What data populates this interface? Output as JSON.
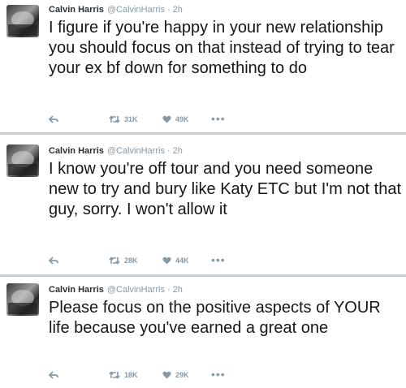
{
  "tweets": [
    {
      "name": "Calvin Harris",
      "handle": "@CalvinHarris",
      "separator": "·",
      "time": "2h",
      "text": "I figure if you're happy in your new relationship you should focus on that instead of trying to tear your ex bf down for something to do",
      "retweets": "31K",
      "likes": "49K",
      "more": "•••"
    },
    {
      "name": "Calvin Harris",
      "handle": "@CalvinHarris",
      "separator": "·",
      "time": "2h",
      "text": "I know you're off tour and you need someone new to try and bury like Katy ETC but I'm not that guy, sorry. I won't allow it",
      "retweets": "28K",
      "likes": "44K",
      "more": "•••"
    },
    {
      "name": "Calvin Harris",
      "handle": "@CalvinHarris",
      "separator": "·",
      "time": "2h",
      "text": "Please focus on the positive aspects of YOUR life because you've earned a great one",
      "retweets": "18K",
      "likes": "29K",
      "more": "•••"
    }
  ],
  "icons": {
    "reply": "reply-icon",
    "retweet": "retweet-icon",
    "like": "heart-icon",
    "more": "more-icon"
  },
  "colors": {
    "text": "#14171a",
    "muted": "#8899a6",
    "divider": "#c9ced3"
  }
}
